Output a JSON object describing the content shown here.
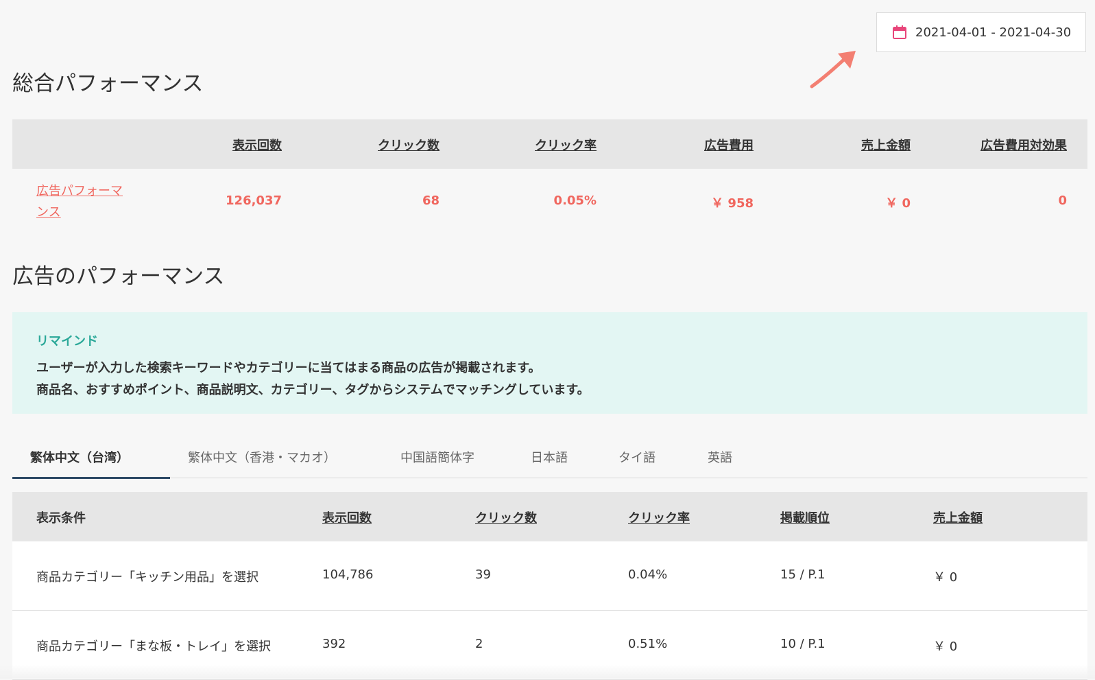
{
  "date_range": "2021-04-01 - 2021-04-30",
  "colors": {
    "accent": "#f0675f",
    "remind": "#2aa898",
    "tab_underline": "#2d4a66",
    "calendar": "#e8457a"
  },
  "overall": {
    "title": "総合パフォーマンス",
    "headers": [
      "表示回数",
      "クリック数",
      "クリック率",
      "広告費用",
      "売上金額",
      "広告費用対効果"
    ],
    "row": {
      "link": "広告パフォーマンス",
      "values": [
        "126,037",
        "68",
        "0.05%",
        "￥ 958",
        "￥ 0",
        "0"
      ]
    }
  },
  "ad": {
    "title": "広告のパフォーマンス",
    "remind": {
      "title": "リマインド",
      "line1": "ユーザーが入力した検索キーワードやカテゴリーに当てはまる商品の広告が掲載されます。",
      "line2": "商品名、おすすめポイント、商品説明文、カテゴリー、タグからシステムでマッチングしています。"
    },
    "tabs": [
      "繁体中文（台湾）",
      "繁体中文（香港・マカオ）",
      "中国語簡体字",
      "日本語",
      "タイ語",
      "英語"
    ],
    "headers": [
      "表示条件",
      "表示回数",
      "クリック数",
      "クリック率",
      "掲載順位",
      "売上金額"
    ],
    "rows": [
      [
        "商品カテゴリー「キッチン用品」を選択",
        "104,786",
        "39",
        "0.04%",
        "15 / P.1",
        "￥ 0"
      ],
      [
        "商品カテゴリー「まな板・トレイ」を選択",
        "392",
        "2",
        "0.51%",
        "10 / P.1",
        "￥ 0"
      ]
    ]
  }
}
